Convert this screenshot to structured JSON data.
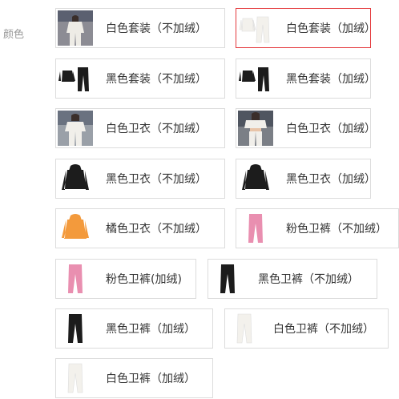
{
  "attribute": {
    "label": "颜色"
  },
  "colors": {
    "selected_border": "#e4393c",
    "border": "#dcdcdc",
    "white_item": "#f3f1ec",
    "black_item": "#1c1c1c",
    "orange_item": "#f39a3c",
    "pink_item": "#e98fb0"
  },
  "options": [
    {
      "label": "白色套装（不加绒）",
      "selected": false,
      "icon": "white-suit-photo"
    },
    {
      "label": "白色套装（加绒）",
      "selected": true,
      "icon": "white-suit"
    },
    {
      "label": "黑色套装（不加绒）",
      "selected": false,
      "icon": "black-suit"
    },
    {
      "label": "黑色套装（加绒）",
      "selected": false,
      "icon": "black-suit"
    },
    {
      "label": "白色卫衣（不加绒）",
      "selected": false,
      "icon": "white-hoodie-photo"
    },
    {
      "label": "白色卫衣（加绒）",
      "selected": false,
      "icon": "white-hoodie-photo"
    },
    {
      "label": "黑色卫衣（不加绒）",
      "selected": false,
      "icon": "black-hoodie"
    },
    {
      "label": "黑色卫衣（加绒）",
      "selected": false,
      "icon": "black-hoodie"
    },
    {
      "label": "橘色卫衣（不加绒）",
      "selected": false,
      "icon": "orange-hoodie"
    },
    {
      "label": "粉色卫裤（不加绒）",
      "selected": false,
      "icon": "pink-pants"
    },
    {
      "label": "粉色卫裤(加绒)",
      "selected": false,
      "icon": "pink-pants"
    },
    {
      "label": "黑色卫裤（不加绒）",
      "selected": false,
      "icon": "black-pants"
    },
    {
      "label": "黑色卫裤（加绒）",
      "selected": false,
      "icon": "black-pants"
    },
    {
      "label": "白色卫裤（不加绒）",
      "selected": false,
      "icon": "white-pants"
    },
    {
      "label": "白色卫裤（加绒）",
      "selected": false,
      "icon": "white-pants"
    }
  ]
}
